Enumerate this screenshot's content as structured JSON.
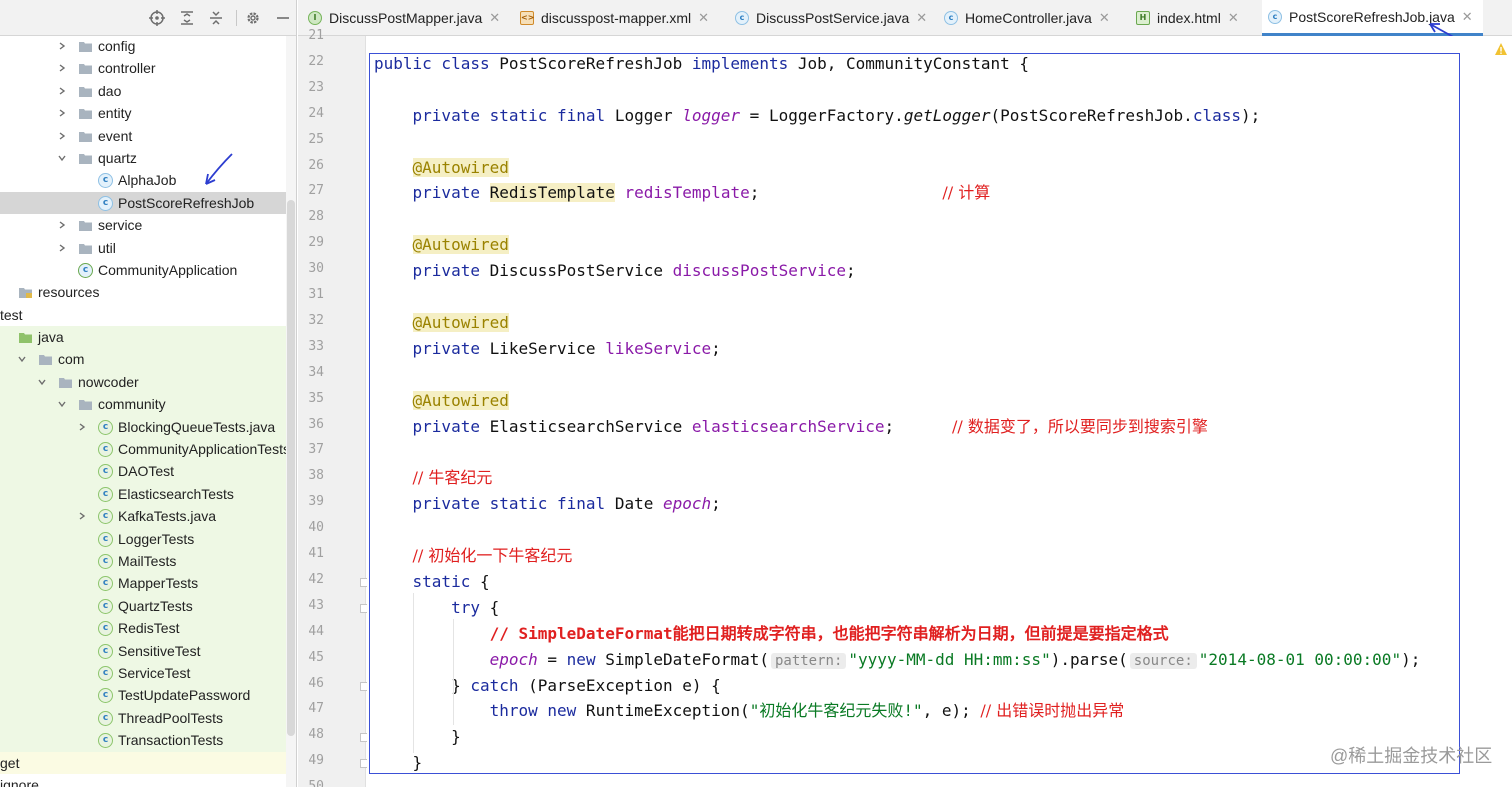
{
  "project_tree": {
    "items": [
      {
        "label": "config",
        "kind": "folder",
        "depth": 3,
        "expandable": true
      },
      {
        "label": "controller",
        "kind": "folder",
        "depth": 3,
        "expandable": true
      },
      {
        "label": "dao",
        "kind": "folder",
        "depth": 3,
        "expandable": true
      },
      {
        "label": "entity",
        "kind": "folder",
        "depth": 3,
        "expandable": true
      },
      {
        "label": "event",
        "kind": "folder",
        "depth": 3,
        "expandable": true
      },
      {
        "label": "quartz",
        "kind": "folder",
        "depth": 3,
        "expanded": true
      },
      {
        "label": "AlphaJob",
        "kind": "class",
        "depth": 4
      },
      {
        "label": "PostScoreRefreshJob",
        "kind": "class",
        "depth": 4,
        "selected": true
      },
      {
        "label": "service",
        "kind": "folder",
        "depth": 3,
        "expandable": true
      },
      {
        "label": "util",
        "kind": "folder",
        "depth": 3,
        "expandable": true
      },
      {
        "label": "CommunityApplication",
        "kind": "app-class",
        "depth": 3
      },
      {
        "label": "resources",
        "kind": "resources-folder",
        "depth": 0
      },
      {
        "label": "test",
        "kind": "text",
        "depth": -1
      },
      {
        "label": "java",
        "kind": "test-folder",
        "depth": 0,
        "green": true
      },
      {
        "label": "com",
        "kind": "folder",
        "depth": 1,
        "expanded": true,
        "green": true
      },
      {
        "label": "nowcoder",
        "kind": "folder",
        "depth": 2,
        "expanded": true,
        "green": true
      },
      {
        "label": "community",
        "kind": "folder",
        "depth": 3,
        "expanded": true,
        "green": true
      },
      {
        "label": "BlockingQueueTests.java",
        "kind": "test-class",
        "depth": 4,
        "expandable": true,
        "green": true
      },
      {
        "label": "CommunityApplicationTests",
        "kind": "test-class",
        "depth": 4,
        "green": true
      },
      {
        "label": "DAOTest",
        "kind": "test-class",
        "depth": 4,
        "green": true
      },
      {
        "label": "ElasticsearchTests",
        "kind": "test-class",
        "depth": 4,
        "green": true
      },
      {
        "label": "KafkaTests.java",
        "kind": "test-class",
        "depth": 4,
        "expandable": true,
        "green": true
      },
      {
        "label": "LoggerTests",
        "kind": "test-class",
        "depth": 4,
        "green": true
      },
      {
        "label": "MailTests",
        "kind": "test-class",
        "depth": 4,
        "green": true
      },
      {
        "label": "MapperTests",
        "kind": "test-class",
        "depth": 4,
        "green": true
      },
      {
        "label": "QuartzTests",
        "kind": "test-class",
        "depth": 4,
        "green": true
      },
      {
        "label": "RedisTest",
        "kind": "test-class",
        "depth": 4,
        "green": true
      },
      {
        "label": "SensitiveTest",
        "kind": "test-class",
        "depth": 4,
        "green": true
      },
      {
        "label": "ServiceTest",
        "kind": "test-class",
        "depth": 4,
        "green": true
      },
      {
        "label": "TestUpdatePassword",
        "kind": "test-class",
        "depth": 4,
        "green": true
      },
      {
        "label": "ThreadPoolTests",
        "kind": "test-class",
        "depth": 4,
        "green": true
      },
      {
        "label": "TransactionTests",
        "kind": "test-class",
        "depth": 4,
        "green": true
      },
      {
        "label": "get",
        "kind": "text",
        "depth": -1,
        "yellow": true
      },
      {
        "label": "ignore",
        "kind": "text",
        "depth": -1
      }
    ]
  },
  "tabs": [
    {
      "label": "DiscussPostMapper.java",
      "icon": "interface-icon",
      "active": false
    },
    {
      "label": "discusspost-mapper.xml",
      "icon": "xml-file-icon",
      "active": false
    },
    {
      "label": "DiscussPostService.java",
      "icon": "class-icon",
      "active": false
    },
    {
      "label": "HomeController.java",
      "icon": "class-icon",
      "active": false
    },
    {
      "label": "index.html",
      "icon": "html-file-icon",
      "active": false
    },
    {
      "label": "PostScoreRefreshJob.java",
      "icon": "class-icon",
      "active": true
    }
  ],
  "editor": {
    "lines": [
      {
        "n": "21",
        "html": ""
      },
      {
        "n": "22",
        "html": "<span class='kw'>public class</span> PostScoreRefreshJob <span class='kw'>implements</span> Job, CommunityConstant {"
      },
      {
        "n": "23",
        "html": ""
      },
      {
        "n": "24",
        "html": "    <span class='kw'>private static final</span> Logger <span class='fldi'>logger</span> = LoggerFactory.<span class='it'>getLogger</span>(PostScoreRefreshJob.<span class='kw'>class</span>);"
      },
      {
        "n": "25",
        "html": ""
      },
      {
        "n": "26",
        "html": "    <span class='ann'>@Autowired</span>"
      },
      {
        "n": "27",
        "html": "    <span class='kw'>private</span> <span class='hl-type'>RedisTemplate</span> <span class='fld'>redisTemplate</span>;                   <span class='cm cn'>// 计算</span>"
      },
      {
        "n": "28",
        "html": ""
      },
      {
        "n": "29",
        "html": "    <span class='ann'>@Autowired</span>"
      },
      {
        "n": "30",
        "html": "    <span class='kw'>private</span> DiscussPostService <span class='fld'>discussPostService</span>;"
      },
      {
        "n": "31",
        "html": ""
      },
      {
        "n": "32",
        "html": "    <span class='ann'>@Autowired</span>"
      },
      {
        "n": "33",
        "html": "    <span class='kw'>private</span> LikeService <span class='fld'>likeService</span>;"
      },
      {
        "n": "34",
        "html": ""
      },
      {
        "n": "35",
        "html": "    <span class='ann'>@Autowired</span>"
      },
      {
        "n": "36",
        "html": "    <span class='kw'>private</span> ElasticsearchService <span class='fld'>elasticsearchService</span>;      <span class='cm cn'>// 数据变了，所以要同步到搜索引擎</span>"
      },
      {
        "n": "37",
        "html": ""
      },
      {
        "n": "38",
        "html": "    <span class='cm cn'>// 牛客纪元</span>"
      },
      {
        "n": "39",
        "html": "    <span class='kw'>private static final</span> Date <span class='fldi'>epoch</span>;"
      },
      {
        "n": "40",
        "html": ""
      },
      {
        "n": "41",
        "html": "    <span class='cm cn'>// 初始化一下牛客纪元</span>"
      },
      {
        "n": "42",
        "html": "    <span class='kw'>static</span> {"
      },
      {
        "n": "43",
        "html": "        <span class='kw'>try</span> {"
      },
      {
        "n": "44",
        "html": "            <span class='cmb'>// SimpleDateFormat<span class='cn'>能把日期转成字符串，也能把字符串解析为日期，但前提是要指定格式</span></span>"
      },
      {
        "n": "45",
        "html": "            <span class='fldi'>epoch</span> = <span class='kw'>new</span> SimpleDateFormat(<span class='hint'>pattern:</span><span class='str'>\"yyyy-MM-dd HH:mm:ss\"</span>).parse(<span class='hint'>source:</span><span class='str'>\"2014-08-01 00:00:00\"</span>);"
      },
      {
        "n": "46",
        "html": "        } <span class='kw'>catch</span> (ParseException e) {"
      },
      {
        "n": "47",
        "html": "            <span class='kw'>throw new</span> RuntimeException(<span class='str'>\"<span class='cn'>初始化牛客纪元失败</span>!\"</span>, e); <span class='cm cn'>// 出错误时抛出异常</span>"
      },
      {
        "n": "48",
        "html": "        }"
      },
      {
        "n": "49",
        "html": "    }"
      },
      {
        "n": "50",
        "html": ""
      }
    ]
  },
  "watermark": "@稀土掘金技术社区",
  "colors": {
    "accent": "#4083c9",
    "selection_border": "#3b50d6",
    "keyword": "#1b2b9e",
    "comment": "#e02020",
    "string": "#0a7a24",
    "field": "#8a1aa8",
    "annotation": "#9a8200"
  }
}
